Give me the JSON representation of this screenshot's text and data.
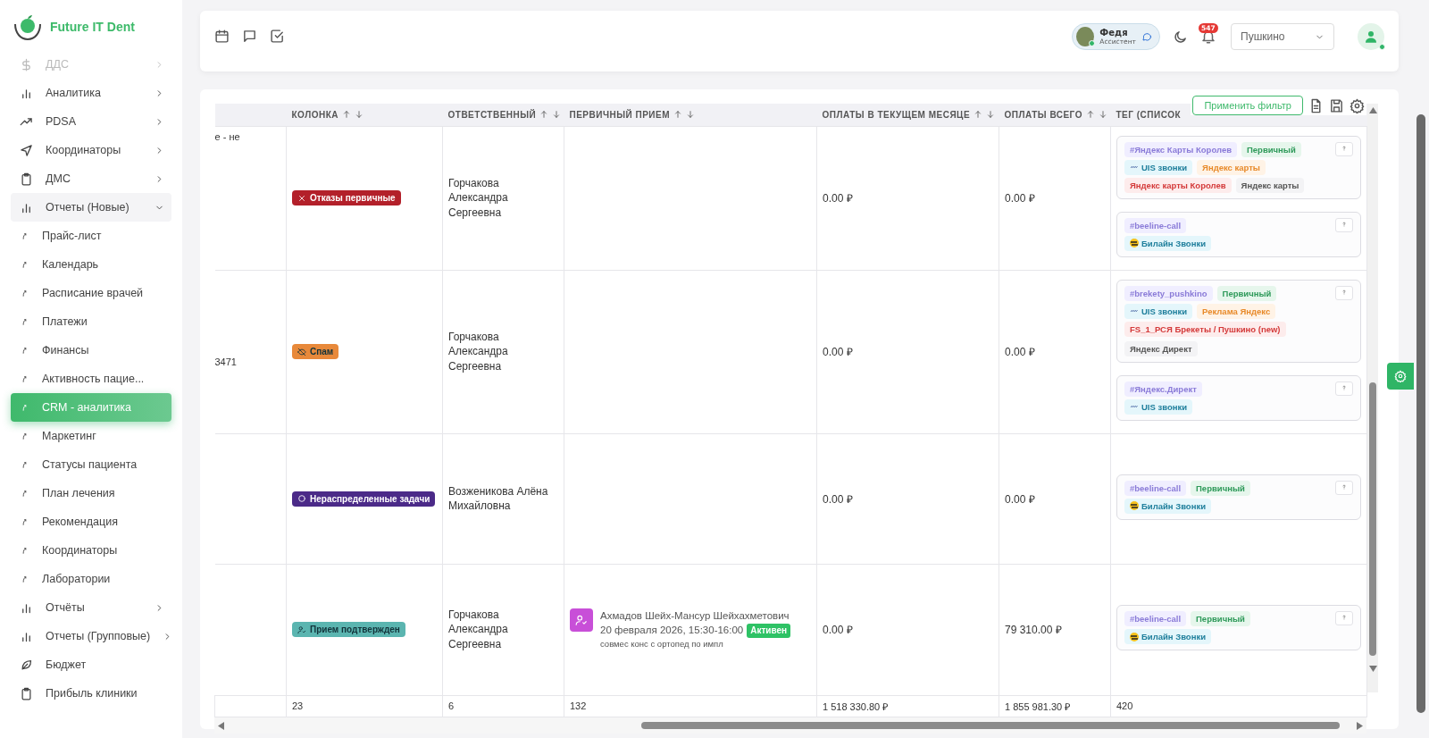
{
  "sidebar": {
    "logo_text": "Future IT Dent",
    "items": [
      {
        "kind": "group",
        "label": "ДДС",
        "disabled": true,
        "expanded": false,
        "selected": false
      },
      {
        "kind": "group",
        "label": "Аналитика",
        "disabled": false,
        "expanded": false,
        "selected": false
      },
      {
        "kind": "group",
        "label": "PDSA",
        "disabled": false,
        "expanded": false,
        "selected": false
      },
      {
        "kind": "group",
        "label": "Координаторы",
        "disabled": false,
        "expanded": false,
        "selected": false
      },
      {
        "kind": "group",
        "label": "ДМС",
        "disabled": false,
        "expanded": false,
        "selected": false
      },
      {
        "kind": "group",
        "label": "Отчеты (Новые)",
        "disabled": false,
        "expanded": true,
        "selected": false,
        "children": [
          {
            "label": "Прайс-лист",
            "selected": false
          },
          {
            "label": "Календарь",
            "selected": false
          },
          {
            "label": "Расписание врачей",
            "selected": false
          },
          {
            "label": "Платежи",
            "selected": false
          },
          {
            "label": "Финансы",
            "selected": false
          },
          {
            "label": "Активность пацие...",
            "selected": false
          },
          {
            "label": "CRM - аналитика",
            "selected": true
          },
          {
            "label": "Маркетинг",
            "selected": false
          },
          {
            "label": "Статусы пациента",
            "selected": false
          },
          {
            "label": "План лечения",
            "selected": false
          },
          {
            "label": "Рекомендация",
            "selected": false
          },
          {
            "label": "Координаторы",
            "selected": false
          },
          {
            "label": "Лаборатории",
            "selected": false
          }
        ]
      },
      {
        "kind": "group",
        "label": "Отчёты",
        "disabled": false,
        "expanded": false,
        "selected": false
      },
      {
        "kind": "group",
        "label": "Отчеты (Групповые)",
        "disabled": false,
        "expanded": false,
        "selected": false
      },
      {
        "kind": "link",
        "label": "Бюджет",
        "disabled": false,
        "selected": false
      },
      {
        "kind": "link",
        "label": "Прибыль клиники",
        "disabled": false,
        "selected": false
      }
    ]
  },
  "header": {
    "assistant": {
      "name": "Федя",
      "role": "Ассистент",
      "online": true
    },
    "notifications_badge": "547",
    "clinic_select": {
      "value": "Пушкино"
    },
    "user_online": true
  },
  "table": {
    "apply_filter_button": "Применить фильтр",
    "columns": [
      {
        "label": "КОЛОНКА",
        "sortable": true
      },
      {
        "label": "ОТВЕТСТВЕННЫЙ",
        "sortable": true
      },
      {
        "label": "ПЕРВИЧНЫЙ ПРИЕМ",
        "sortable": true
      },
      {
        "label": "ОПЛАТЫ В ТЕКУЩЕМ МЕСЯЦЕ",
        "sortable": true
      },
      {
        "label": "ОПЛАТЫ ВСЕГО",
        "sortable": true
      },
      {
        "label": "ТЕГ (СПИСОК",
        "sortable": false
      }
    ],
    "rows": [
      {
        "column_1": "е - не",
        "status": {
          "label": "Отказы первичные",
          "kind": "rejected",
          "color": "#b3202a"
        },
        "responsible": "Горчакова Александра Сергеевна",
        "payments_month": "0.00 ₽",
        "payments_total": "0.00 ₽",
        "tag_groups": [
          [
            {
              "kind": "hashtag",
              "label": "#Яндекс Карты Королев"
            },
            {
              "kind": "primary",
              "label": "Первичный"
            },
            {
              "kind": "uis",
              "label": "UIS звонки"
            },
            {
              "kind": "channel",
              "label": "Яндекс карты"
            },
            {
              "kind": "campaign",
              "label": "Яндекс карты Королев"
            },
            {
              "kind": "plain",
              "label": "Яндекс карты"
            }
          ],
          [
            {
              "kind": "hashtag",
              "label": "#beeline-call"
            },
            {
              "kind": "beeline",
              "label": "Билайн Звонки"
            }
          ]
        ]
      },
      {
        "column_1": "3471",
        "status": {
          "label": "Спам",
          "kind": "spam",
          "color": "#e8893a"
        },
        "responsible": "Горчакова Александра Сергеевна",
        "payments_month": "0.00 ₽",
        "payments_total": "0.00 ₽",
        "tag_groups": [
          [
            {
              "kind": "hashtag",
              "label": "#brekety_pushkino"
            },
            {
              "kind": "primary",
              "label": "Первичный"
            },
            {
              "kind": "uis",
              "label": "UIS звонки"
            },
            {
              "kind": "channel",
              "label": "Реклама Яндекс"
            },
            {
              "kind": "campaign",
              "label": "FS_1_РСЯ Брекеты / Пушкино (new)"
            },
            {
              "kind": "plain",
              "label": "Яндекс Директ"
            }
          ],
          [
            {
              "kind": "hashtag",
              "label": "#Яндекс.Директ"
            },
            {
              "kind": "uis",
              "label": "UIS звонки"
            }
          ]
        ]
      },
      {
        "status": {
          "label": "Нераспределенные задачи",
          "kind": "unassigned",
          "color": "#4b2a88"
        },
        "responsible": "Возженикова Алёна Михайловна",
        "payments_month": "0.00 ₽",
        "payments_total": "0.00 ₽",
        "tag_groups": [
          [
            {
              "kind": "hashtag",
              "label": "#beeline-call"
            },
            {
              "kind": "primary",
              "label": "Первичный"
            },
            {
              "kind": "beeline",
              "label": "Билайн Звонки"
            }
          ]
        ]
      },
      {
        "status": {
          "label": "Прием подтвержден",
          "kind": "confirmed",
          "color": "#5bb5b0"
        },
        "responsible": "Горчакова Александра Сергеевна",
        "appointment": {
          "patient": "Ахмадов Шейх-Мансур Шейхахметович",
          "datetime": "20 февраля 2026, 15:30-16:00",
          "state": "Активен",
          "note": "совмес конс с ортопед по импл"
        },
        "payments_month": "0.00 ₽",
        "payments_total": "79 310.00 ₽",
        "tag_groups": [
          [
            {
              "kind": "hashtag",
              "label": "#beeline-call"
            },
            {
              "kind": "primary",
              "label": "Первичный"
            },
            {
              "kind": "beeline",
              "label": "Билайн Звонки"
            }
          ]
        ]
      }
    ],
    "totals": [
      "23",
      "6",
      "132",
      "1 518 330.80 ₽",
      "1 855 981.30 ₽",
      "420"
    ]
  }
}
